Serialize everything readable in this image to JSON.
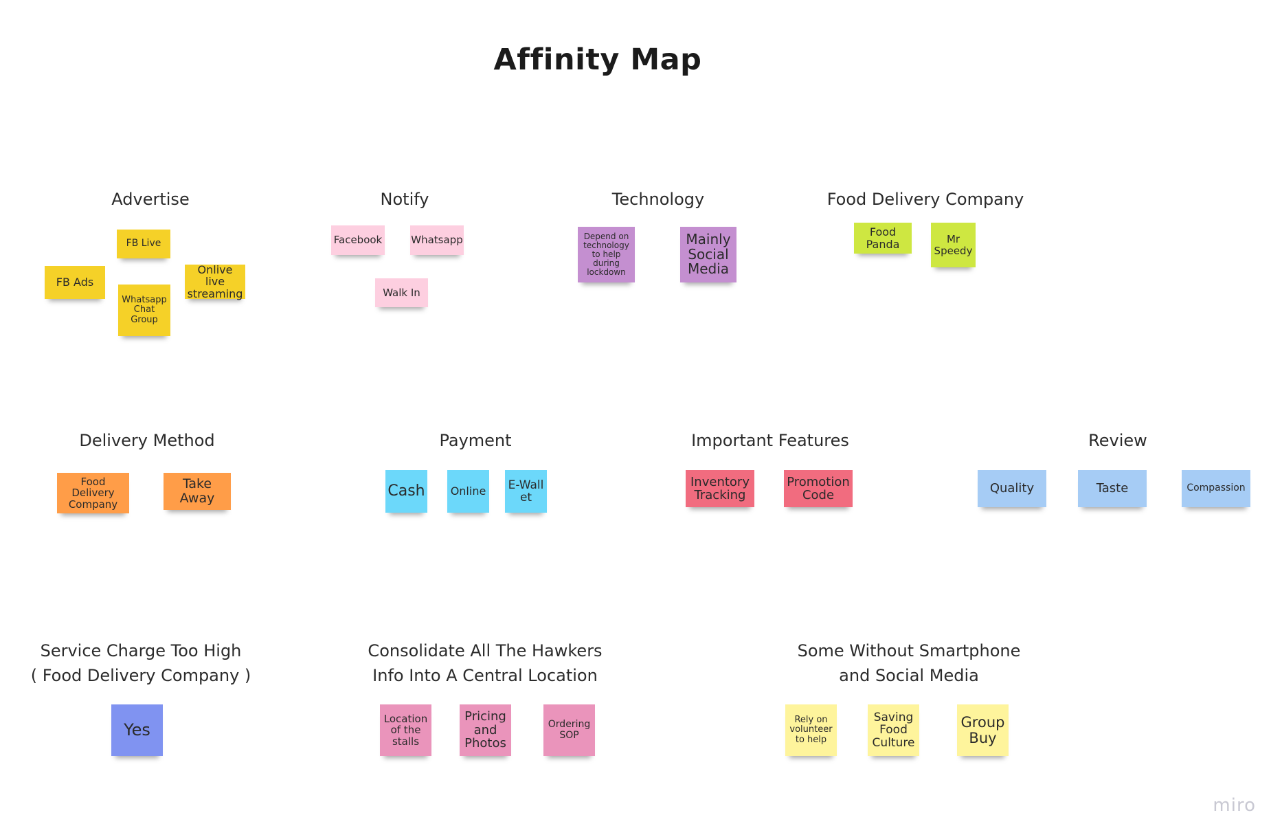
{
  "title": "Affinity Map",
  "watermark": "miro",
  "colors": {
    "yellow": "#f5d128",
    "light_pink": "#fdcfe0",
    "violet": "#c48fd0",
    "lime": "#cee741",
    "orange": "#ff9d48",
    "cyan": "#6cd8fa",
    "red": "#f16c7f",
    "light_blue": "#a6ccf5",
    "blue": "#8093f1",
    "pink": "#ea94bb",
    "light_yellow": "#fef49c"
  },
  "groups": [
    {
      "heading": "Advertise",
      "notes": [
        "FB Live",
        "FB Ads",
        "Whatsapp Chat Group",
        "Onlive live streaming"
      ]
    },
    {
      "heading": "Notify",
      "notes": [
        "Facebook",
        "Whatsapp",
        "Walk In"
      ]
    },
    {
      "heading": "Technology",
      "notes": [
        "Depend on technology to help during lockdown",
        "Mainly Social Media"
      ]
    },
    {
      "heading": "Food Delivery Company",
      "notes": [
        "Food Panda",
        "Mr Speedy"
      ]
    },
    {
      "heading": "Delivery Method",
      "notes": [
        "Food Delivery Company",
        "Take Away"
      ]
    },
    {
      "heading": "Payment",
      "notes": [
        "Cash",
        "Online",
        "E-Wallet"
      ]
    },
    {
      "heading": "Important Features",
      "notes": [
        "Inventory Tracking",
        "Promotion Code"
      ]
    },
    {
      "heading": "Review",
      "notes": [
        "Quality",
        "Taste",
        "Compassion"
      ]
    },
    {
      "heading_lines": [
        "Service Charge Too High",
        "( Food Delivery Company )"
      ],
      "notes": [
        "Yes"
      ]
    },
    {
      "heading_lines": [
        "Consolidate All The Hawkers",
        "Info Into A Central Location"
      ],
      "notes": [
        "Location of the stalls",
        "Pricing and Photos",
        "Ordering SOP"
      ]
    },
    {
      "heading_lines": [
        "Some Without Smartphone",
        "and Social Media"
      ],
      "notes": [
        "Rely on volunteer to help",
        "Saving Food Culture",
        "Group Buy"
      ]
    }
  ]
}
